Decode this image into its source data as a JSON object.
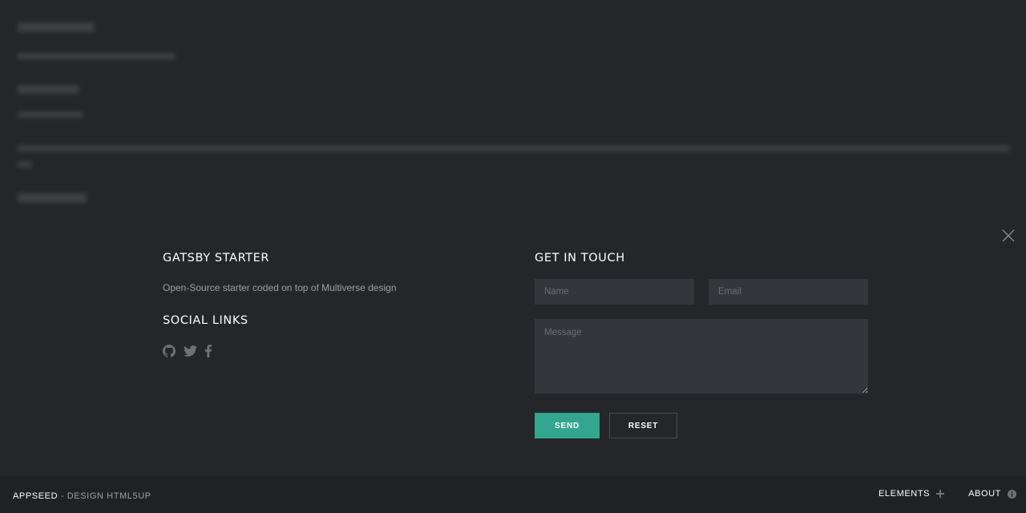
{
  "left": {
    "title": "GATSBY STARTER",
    "description": "Open-Source starter coded on top of Multiverse design",
    "social_title": "SOCIAL LINKS",
    "social_icons": [
      "github-icon",
      "twitter-icon",
      "facebook-icon"
    ]
  },
  "contact": {
    "title": "GET IN TOUCH",
    "name_placeholder": "Name",
    "email_placeholder": "Email",
    "message_placeholder": "Message",
    "send_label": "SEND",
    "reset_label": "RESET"
  },
  "footer": {
    "brand": "APPSEED",
    "brand_sub": " - DESIGN HTML5UP",
    "nav": [
      {
        "label": "ELEMENTS",
        "icon": "plus-icon"
      },
      {
        "label": "ABOUT",
        "icon": "info-icon"
      }
    ]
  },
  "colors": {
    "background": "#242629",
    "accent": "#34a58e",
    "footer": "#1f2224",
    "field": "#35363b"
  }
}
